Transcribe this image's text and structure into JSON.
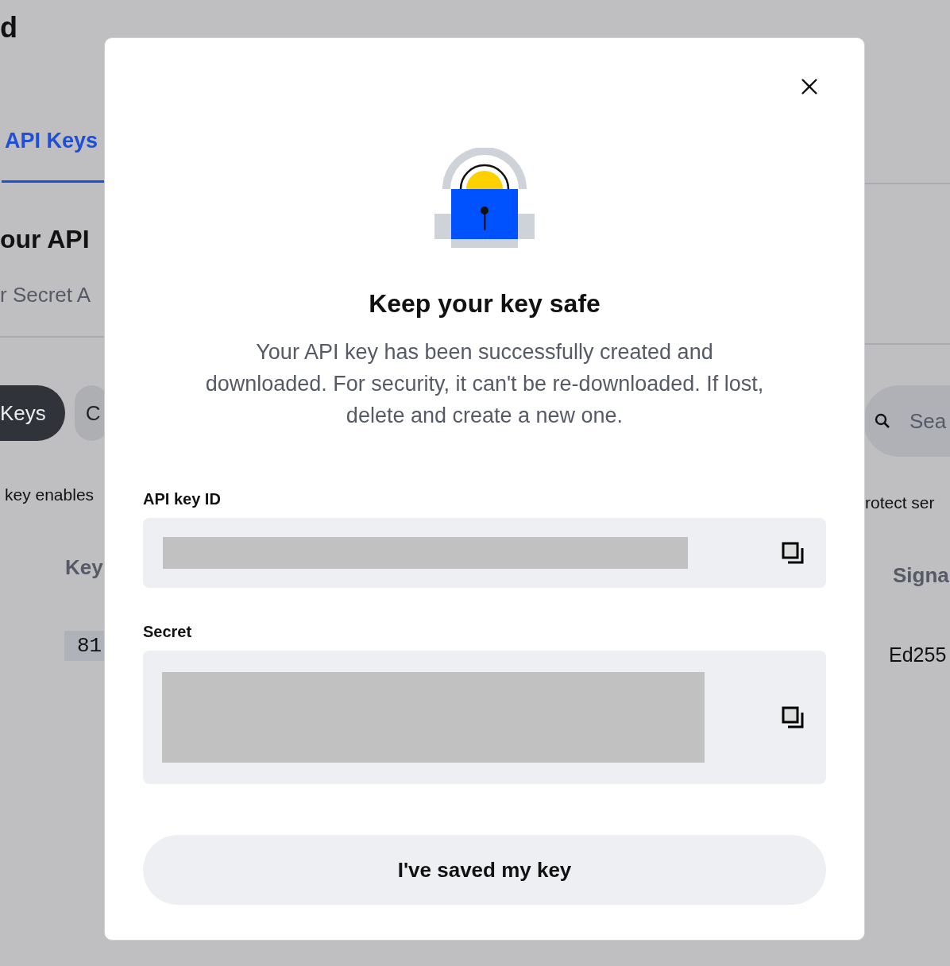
{
  "background": {
    "title": "d",
    "tabs": [
      {
        "label": "API Keys",
        "selected": true
      }
    ],
    "heading": "our API",
    "subtitle": "r Secret A",
    "chips": [
      {
        "label": "Keys",
        "selected": true
      },
      {
        "label": "C",
        "selected": false
      }
    ],
    "description": "key enables",
    "description_right": "rotect ser",
    "search": {
      "placeholder": "Sea"
    },
    "table": {
      "columns": [
        "Key",
        "Signa"
      ],
      "rows": [
        [
          "81",
          "Ed255"
        ]
      ]
    }
  },
  "dialog": {
    "title": "Keep your key safe",
    "message": "Your API key has been successfully created and downloaded. For security, it can't be re-downloaded. If lost, delete and create a new one.",
    "fields": [
      {
        "label": "API key ID",
        "kind": "short"
      },
      {
        "label": "Secret",
        "kind": "tall"
      }
    ],
    "button": "I've saved my key"
  }
}
